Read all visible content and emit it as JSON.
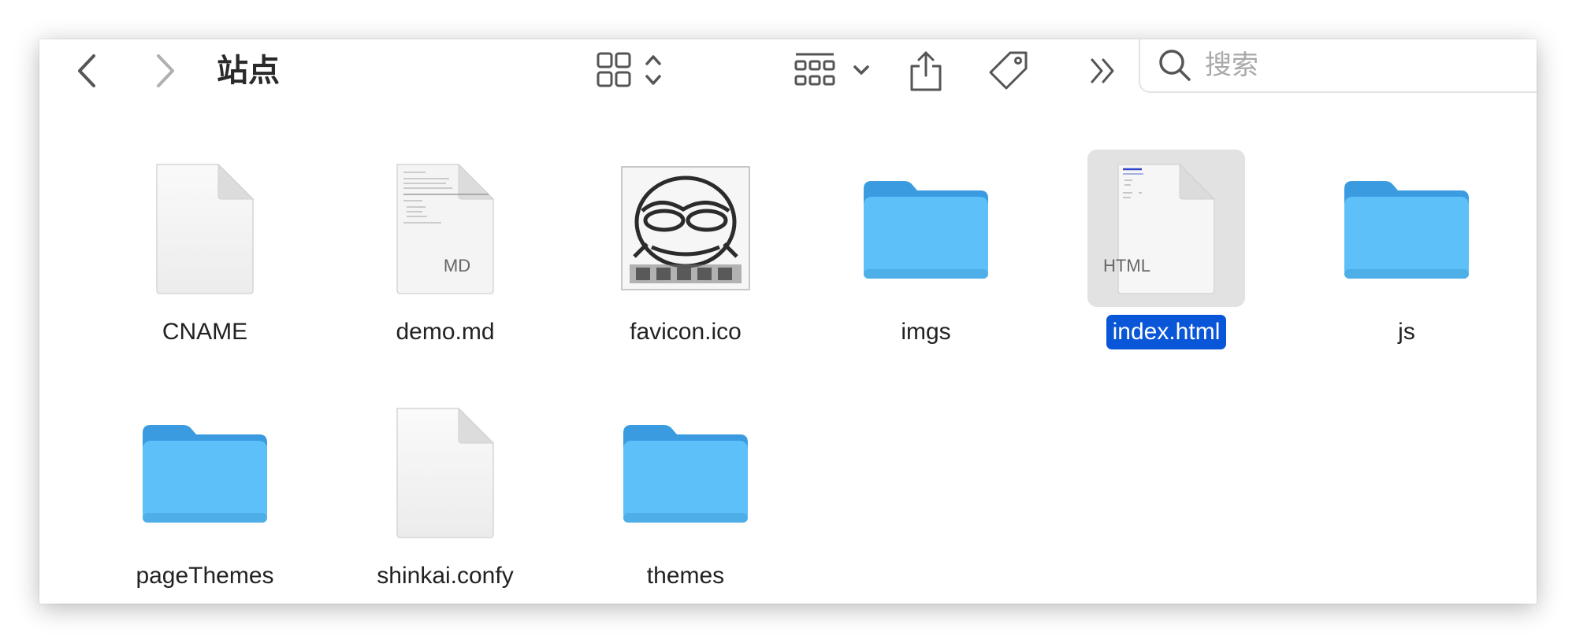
{
  "window": {
    "title": "站点"
  },
  "toolbar": {
    "back_icon": "chevron-left-icon",
    "forward_icon": "chevron-right-icon",
    "view_icon": "grid-view-icon",
    "group_icon": "group-by-icon",
    "share_icon": "share-icon",
    "tag_icon": "tag-icon",
    "more_icon": "double-chevron-icon"
  },
  "search": {
    "placeholder": "搜索",
    "value": ""
  },
  "colors": {
    "folder": "#5ec0f8",
    "folder_tab": "#3a9be0",
    "selection": "#0a56d8",
    "selection_bg": "#e2e2e2"
  },
  "files": [
    {
      "name": "CNAME",
      "kind": "document",
      "badge": ""
    },
    {
      "name": "demo.md",
      "kind": "document",
      "badge": "MD"
    },
    {
      "name": "favicon.ico",
      "kind": "image",
      "badge": ""
    },
    {
      "name": "imgs",
      "kind": "folder",
      "badge": ""
    },
    {
      "name": "index.html",
      "kind": "document",
      "badge": "HTML",
      "selected": true
    },
    {
      "name": "js",
      "kind": "folder",
      "badge": ""
    },
    {
      "name": "pageThemes",
      "kind": "folder",
      "badge": ""
    },
    {
      "name": "shinkai.confy",
      "kind": "document",
      "badge": ""
    },
    {
      "name": "themes",
      "kind": "folder",
      "badge": ""
    }
  ]
}
